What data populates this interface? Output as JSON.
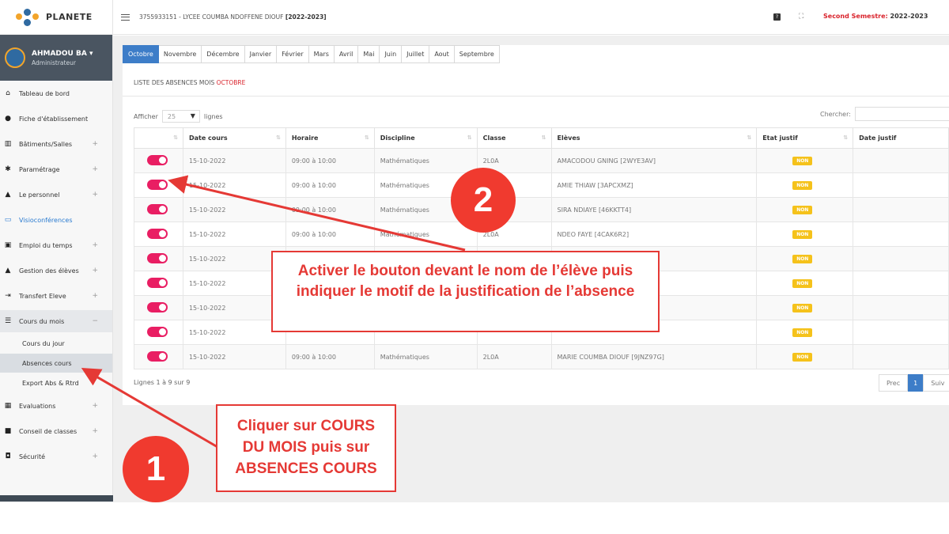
{
  "brand": {
    "name": "PLANETE"
  },
  "user": {
    "name": "AHMADOU BA",
    "role": "Administrateur"
  },
  "topbar": {
    "school_prefix": "3755933151 - LYCEE COUMBA NDOFFENE DIOUF",
    "school_year": "[2022-2023]",
    "semester_label": "Second Semestre:",
    "semester_value": "2022-2023"
  },
  "sidebar": {
    "items": [
      {
        "label": "Tableau de bord",
        "icon": "home-icon"
      },
      {
        "label": "Fiche d'établissement",
        "icon": "info-icon"
      },
      {
        "label": "Bâtiments/Salles",
        "icon": "building-icon"
      },
      {
        "label": "Paramétrage",
        "icon": "gear-icon"
      },
      {
        "label": "Le personnel",
        "icon": "user-icon"
      },
      {
        "label": "Visioconférences",
        "icon": "laptop-icon"
      },
      {
        "label": "Emploi du temps",
        "icon": "calendar-icon"
      },
      {
        "label": "Gestion des élèves",
        "icon": "student-icon"
      },
      {
        "label": "Transfert Eleve",
        "icon": "transfer-icon"
      },
      {
        "label": "Cours du mois",
        "icon": "list-icon"
      },
      {
        "label": "Evaluations",
        "icon": "grid-icon"
      },
      {
        "label": "Conseil de classes",
        "icon": "folder-icon"
      },
      {
        "label": "Sécurité",
        "icon": "lock-icon"
      }
    ],
    "subitems": [
      "Cours du jour",
      "Absences cours",
      "Export Abs & Rtrd"
    ]
  },
  "months": [
    "Octobre",
    "Novembre",
    "Décembre",
    "Janvier",
    "Février",
    "Mars",
    "Avril",
    "Mai",
    "Juin",
    "Juillet",
    "Aout",
    "Septembre"
  ],
  "list_title": {
    "prefix": "LISTE DES ABSENCES MOIS",
    "month": "OCTOBRE"
  },
  "controls": {
    "show_label": "Afficher",
    "show_value": "25",
    "rows_label": "lignes",
    "search_label": "Chercher:"
  },
  "table": {
    "headers": [
      "Date cours",
      "Horaire",
      "Discipline",
      "Classe",
      "Elèves",
      "Etat justif",
      "Date justif"
    ],
    "rows": [
      {
        "date": "15-10-2022",
        "horaire": "09:00 à 10:00",
        "discipline": "Mathématiques",
        "classe": "2L0A",
        "eleve": "AMACODOU GNING [2WYE3AV]",
        "etat": "NON"
      },
      {
        "date": "15-10-2022",
        "horaire": "09:00 à 10:00",
        "discipline": "Mathématiques",
        "classe": "",
        "eleve": "AMIE THIAW [3APCXMZ]",
        "etat": "NON"
      },
      {
        "date": "15-10-2022",
        "horaire": "09:00 à 10:00",
        "discipline": "Mathématiques",
        "classe": "",
        "eleve": "SIRA NDIAYE [46KKTT4]",
        "etat": "NON"
      },
      {
        "date": "15-10-2022",
        "horaire": "09:00 à 10:00",
        "discipline": "Mathématiques",
        "classe": "2L0A",
        "eleve": "NDEO FAYE [4CAK6R2]",
        "etat": "NON"
      },
      {
        "date": "15-10-2022",
        "horaire": "",
        "discipline": "",
        "classe": "",
        "eleve": "",
        "etat": "NON"
      },
      {
        "date": "15-10-2022",
        "horaire": "",
        "discipline": "",
        "classe": "",
        "eleve": "",
        "etat": "NON"
      },
      {
        "date": "15-10-2022",
        "horaire": "",
        "discipline": "",
        "classe": "",
        "eleve": "",
        "etat": "NON"
      },
      {
        "date": "15-10-2022",
        "horaire": "",
        "discipline": "",
        "classe": "",
        "eleve": "",
        "etat": "NON"
      },
      {
        "date": "15-10-2022",
        "horaire": "09:00 à 10:00",
        "discipline": "Mathématiques",
        "classe": "2L0A",
        "eleve": "MARIE COUMBA DIOUF [9JNZ97G]",
        "etat": "NON"
      }
    ]
  },
  "footer": {
    "count": "Lignes 1 à 9 sur 9"
  },
  "pager": {
    "prev": "Prec",
    "current": "1",
    "next": "Suiv"
  },
  "annotations": {
    "step1_number": "1",
    "step1_text": "Cliquer sur COURS DU MOIS puis sur ABSENCES COURS",
    "step2_number": "2",
    "step2_text": "Activer le bouton devant le nom de l’élève puis indiquer le motif de la justification de l’absence",
    "color": "#e53935"
  }
}
